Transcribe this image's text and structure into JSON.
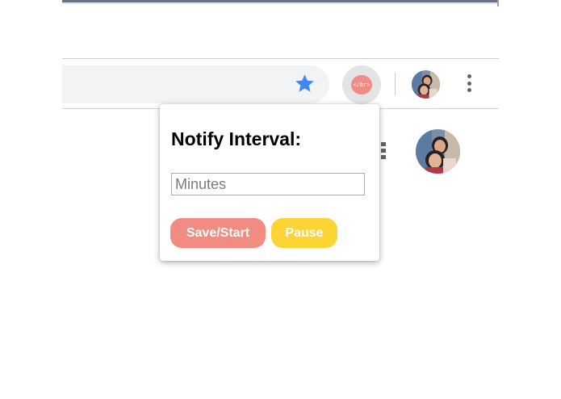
{
  "toolbar": {
    "extension_badge": "</br>",
    "bookmark_icon": "star-icon",
    "menu_icon": "vertical-dots-icon"
  },
  "popup": {
    "title": "Notify Interval:",
    "input_placeholder": "Minutes",
    "input_value": "",
    "save_label": "Save/Start",
    "pause_label": "Pause"
  },
  "colors": {
    "star": "#4285f4",
    "save_button": "#f28b82",
    "pause_button": "#fcd535",
    "omnibox": "#f1f3f4"
  }
}
